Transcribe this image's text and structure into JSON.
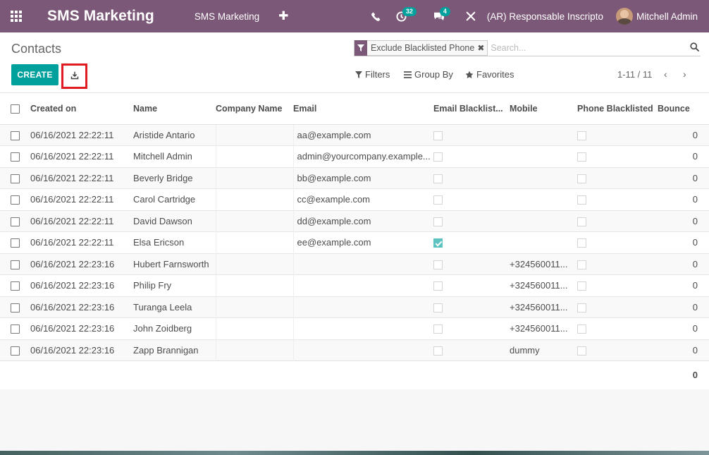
{
  "navbar": {
    "brand": "SMS Marketing",
    "menu_item": "SMS Marketing",
    "plus": "✚",
    "activity_count": "32",
    "message_count": "4",
    "company": "(AR) Responsable Inscripto",
    "user": "Mitchell Admin"
  },
  "control_panel": {
    "breadcrumb": "Contacts",
    "facet": "Exclude Blacklisted Phone",
    "search_placeholder": "Search...",
    "create_label": "CREATE",
    "filters_label": "Filters",
    "group_by_label": "Group By",
    "favorites_label": "Favorites",
    "pager": "1-11 / 11",
    "pager_prev": "‹",
    "pager_next": "›"
  },
  "table": {
    "columns": {
      "created_on": "Created on",
      "name": "Name",
      "company": "Company Name",
      "email": "Email",
      "email_bl": "Email Blacklist...",
      "mobile": "Mobile",
      "phone_bl": "Phone Blacklisted",
      "bounce": "Bounce"
    },
    "rows": [
      {
        "created": "06/16/2021 22:22:11",
        "name": "Aristide Antario",
        "company": "",
        "email": "aa@example.com",
        "email_bl": false,
        "mobile": "",
        "phone_bl": false,
        "bounce": "0"
      },
      {
        "created": "06/16/2021 22:22:11",
        "name": "Mitchell Admin",
        "company": "",
        "email": "admin@yourcompany.example...",
        "email_bl": false,
        "mobile": "",
        "phone_bl": false,
        "bounce": "0"
      },
      {
        "created": "06/16/2021 22:22:11",
        "name": "Beverly Bridge",
        "company": "",
        "email": "bb@example.com",
        "email_bl": false,
        "mobile": "",
        "phone_bl": false,
        "bounce": "0"
      },
      {
        "created": "06/16/2021 22:22:11",
        "name": "Carol Cartridge",
        "company": "",
        "email": "cc@example.com",
        "email_bl": false,
        "mobile": "",
        "phone_bl": false,
        "bounce": "0"
      },
      {
        "created": "06/16/2021 22:22:11",
        "name": "David Dawson",
        "company": "",
        "email": "dd@example.com",
        "email_bl": false,
        "mobile": "",
        "phone_bl": false,
        "bounce": "0"
      },
      {
        "created": "06/16/2021 22:22:11",
        "name": "Elsa Ericson",
        "company": "",
        "email": "ee@example.com",
        "email_bl": true,
        "mobile": "",
        "phone_bl": false,
        "bounce": "0"
      },
      {
        "created": "06/16/2021 22:23:16",
        "name": "Hubert Farnsworth",
        "company": "",
        "email": "",
        "email_bl": false,
        "mobile": "+324560011...",
        "phone_bl": false,
        "bounce": "0"
      },
      {
        "created": "06/16/2021 22:23:16",
        "name": "Philip Fry",
        "company": "",
        "email": "",
        "email_bl": false,
        "mobile": "+324560011...",
        "phone_bl": false,
        "bounce": "0"
      },
      {
        "created": "06/16/2021 22:23:16",
        "name": "Turanga Leela",
        "company": "",
        "email": "",
        "email_bl": false,
        "mobile": "+324560011...",
        "phone_bl": false,
        "bounce": "0"
      },
      {
        "created": "06/16/2021 22:23:16",
        "name": "John Zoidberg",
        "company": "",
        "email": "",
        "email_bl": false,
        "mobile": "+324560011...",
        "phone_bl": false,
        "bounce": "0"
      },
      {
        "created": "06/16/2021 22:23:16",
        "name": "Zapp Brannigan",
        "company": "",
        "email": "",
        "email_bl": false,
        "mobile": "dummy",
        "phone_bl": false,
        "bounce": "0"
      }
    ],
    "footer_bounce_total": "0"
  },
  "colors": {
    "navbar": "#7c5878",
    "primary": "#00a09d",
    "highlight": "#e01b24"
  },
  "icons": [
    "apps-grid-icon",
    "phone-icon",
    "activity-clock-icon",
    "chat-icon",
    "debug-tools-icon",
    "filter-icon",
    "search-icon",
    "download-icon",
    "list-icon",
    "star-icon"
  ]
}
